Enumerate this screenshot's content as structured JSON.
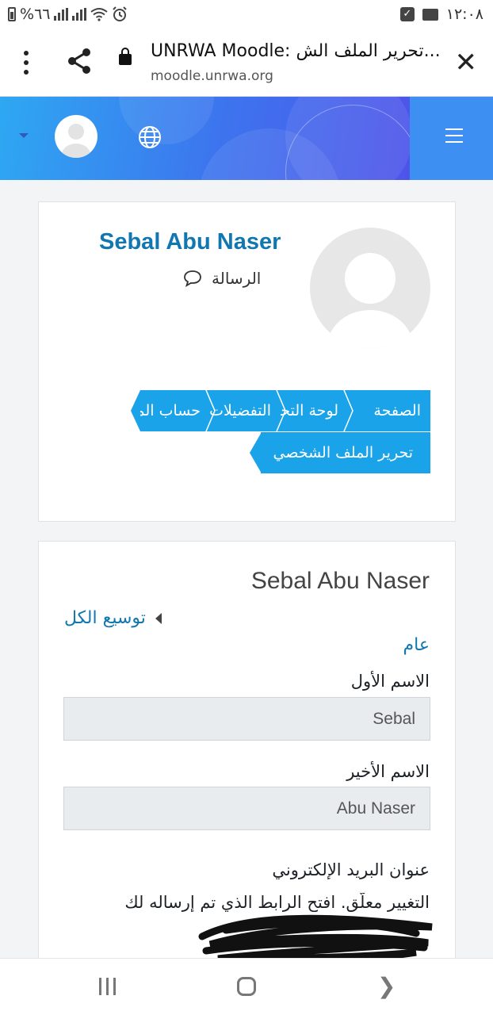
{
  "status_bar": {
    "time": "١٢:٠٨",
    "battery_text": "%٦٦"
  },
  "browser": {
    "page_title": "UNRWA Moodle: تحرير الملف الش...",
    "url": "moodle.unrwa.org",
    "icons": [
      "close-icon",
      "lock-icon",
      "share-icon",
      "more-vert-icon"
    ]
  },
  "navbar": {
    "icons": [
      "hamburger-icon",
      "globe-icon",
      "user-avatar-icon",
      "caret-down-icon"
    ],
    "colors": {
      "start": "#2ea8f2",
      "end": "#5546e8"
    }
  },
  "profile": {
    "name": "Sebal Abu Naser",
    "message_label": "الرسالة"
  },
  "breadcrumbs": [
    {
      "label": "الصفحة"
    },
    {
      "label": "لوحة التحكم"
    },
    {
      "label": "التفضيلات"
    },
    {
      "label": "حساب المستخدم"
    },
    {
      "label": "تحرير الملف الشخصي"
    }
  ],
  "form": {
    "title": "Sebal Abu Naser",
    "expand_all": "توسيع الكل",
    "section_general": "عام",
    "first_name_label": "الاسم الأول",
    "first_name_value": "Sebal",
    "last_name_label": "الاسم الأخير",
    "last_name_value": "Abu Naser",
    "email_label": "عنوان البريد الإلكتروني",
    "email_pending_note": "التغيير معلّق. افتح الرابط الذي تم إرساله لك"
  },
  "bottom_nav": {
    "icons": [
      "recent-apps-icon",
      "home-icon",
      "back-icon"
    ]
  },
  "accent_color": "#1ba3ea",
  "link_color": "#1177b1"
}
